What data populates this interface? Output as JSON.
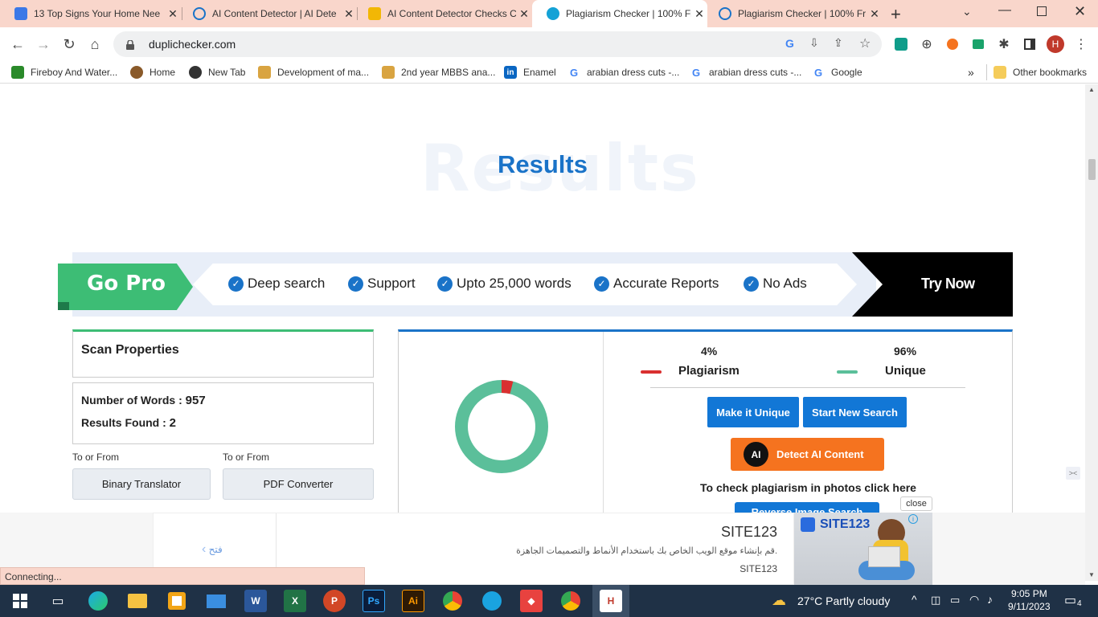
{
  "browser": {
    "tabs": [
      {
        "title": "13 Top Signs Your Home Nee",
        "color": "#3b78e7"
      },
      {
        "title": "AI Content Detector | AI Dete",
        "color": "#1a73c8"
      },
      {
        "title": "AI Content Detector Checks C",
        "color": "#f2b705"
      },
      {
        "title": "Plagiarism Checker | 100% Fr",
        "color": "#14a2d6"
      },
      {
        "title": "Plagiarism Checker | 100% Fr",
        "color": "#1a73c8"
      }
    ],
    "new_tab_glyph": "+",
    "url": "duplichecker.com",
    "profile_initial": "H",
    "bookmarks": [
      {
        "label": "Fireboy And Water...",
        "color": "#2a8a2a"
      },
      {
        "label": "Home",
        "color": "#8a5a2a"
      },
      {
        "label": "New Tab",
        "color": "#333333"
      },
      {
        "label": "Development of ma...",
        "color": "#d9a441"
      },
      {
        "label": "2nd year MBBS ana...",
        "color": "#d9a441"
      },
      {
        "label": "Enamel",
        "color": "#0a66c2"
      },
      {
        "label": "arabian dress cuts -...",
        "color": "#4285f4"
      },
      {
        "label": "arabian dress cuts -...",
        "color": "#4285f4"
      },
      {
        "label": "Google",
        "color": "#4285f4"
      }
    ],
    "other_bookmarks": "Other bookmarks",
    "status": "Connecting..."
  },
  "page": {
    "ghost_title": "Results",
    "title": "Results",
    "gopro": {
      "label": "Go Pro",
      "features": [
        "Deep search",
        "Support",
        "Upto 25,000 words",
        "Accurate Reports",
        "No Ads"
      ],
      "cta": "Try Now"
    },
    "scan": {
      "heading": "Scan Properties",
      "words_label": "Number of Words :",
      "words_value": "957",
      "results_label": "Results Found :",
      "results_value": "2",
      "to_from": "To or From",
      "tools": [
        "Binary Translator",
        "PDF Converter"
      ]
    },
    "result": {
      "plag_pct": "4%",
      "plag_label": "Plagiarism",
      "unique_pct": "96%",
      "unique_label": "Unique",
      "plag_color": "#d93030",
      "unique_color": "#5bbf9a",
      "make_unique": "Make it Unique",
      "new_search": "Start New Search",
      "detect_ai": "Detect AI Content",
      "ai_badge": "AI",
      "photo_text": "To check plagiarism in photos click here",
      "reverse": "Reverse Image Search"
    }
  },
  "ad": {
    "brand": "SITE123",
    "desc": "قم بإنشاء موقع الويب الخاص بك باستخدام الأنماط والتصميمات الجاهزة.",
    "brand_small": "SITE123",
    "open": "فتح",
    "close": "close",
    "logo_text": "SITE123"
  },
  "taskbar": {
    "weather": "27°C  Partly cloudy",
    "time": "9:05 PM",
    "date": "9/11/2023",
    "notifications": "4"
  }
}
